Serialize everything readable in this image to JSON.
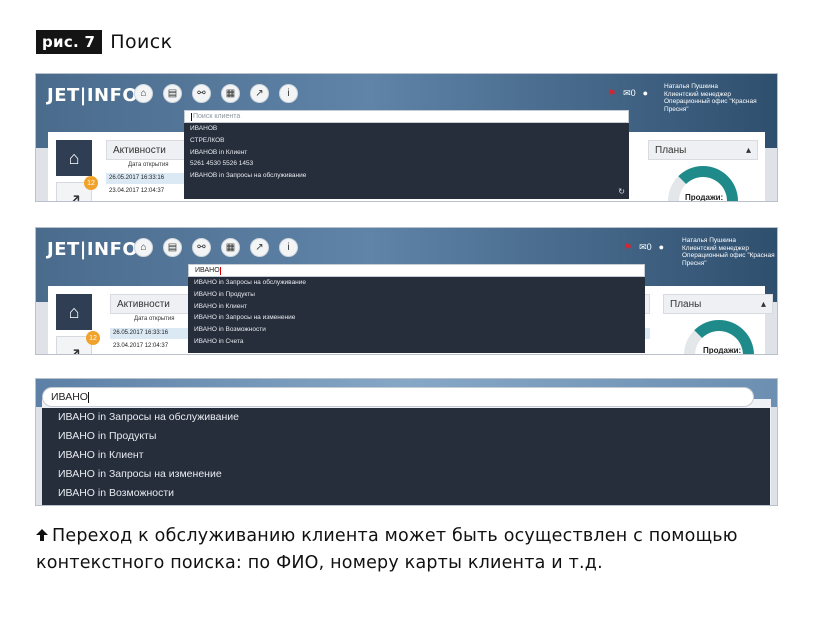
{
  "figure": {
    "badge": "рис. 7",
    "title": "Поиск"
  },
  "app": {
    "logo": "JET|INFO",
    "user": {
      "name": "Наталья Пушкина",
      "role": "Клиентский менеджер",
      "office": "Операционный офис \"Красная Пресня\""
    },
    "notifications_count": "0",
    "panels": {
      "activities": "Активности",
      "plans": "Планы",
      "date_col": "Дата открытия",
      "sales": "Продажи:",
      "badge": "12"
    },
    "rows": [
      "26.05.2017 16:33:16",
      "23.04.2017 12:04:37"
    ]
  },
  "screens": [
    {
      "search_placeholder": "Поиск клиента",
      "results": [
        "ИВАНОВ",
        "СТРЕЛКОВ",
        "ИВАНОВ in Клиент",
        "5261 4530 5526 1453",
        "ИВАНОВ in Запросы на обслуживание"
      ]
    },
    {
      "search_value": "ИВАНО",
      "results": [
        "ИВАНО in Запросы на обслуживание",
        "ИВАНО in Продукты",
        "ИВАНО in Клиент",
        "ИВАНО in Запросы на изменение",
        "ИВАНО in Возможности",
        "ИВАНО in Счета"
      ]
    },
    {
      "search_value": "ИВАНО",
      "results": [
        "ИВАНО in Запросы на обслуживание",
        "ИВАНО in Продукты",
        "ИВАНО in Клиент",
        "ИВАНО in Запросы на изменение",
        "ИВАНО in Возможности"
      ]
    }
  ],
  "caption": "Переход к обслуживанию клиента может быть осуществлен с помощью контекстного поиска: по ФИО, номеру карты клиента и т.д.",
  "colors": {
    "dropdown": "#262d3b",
    "header": "#4a6b8c",
    "accent_ring": "#1f8a8a",
    "badge": "#f0a22a"
  }
}
